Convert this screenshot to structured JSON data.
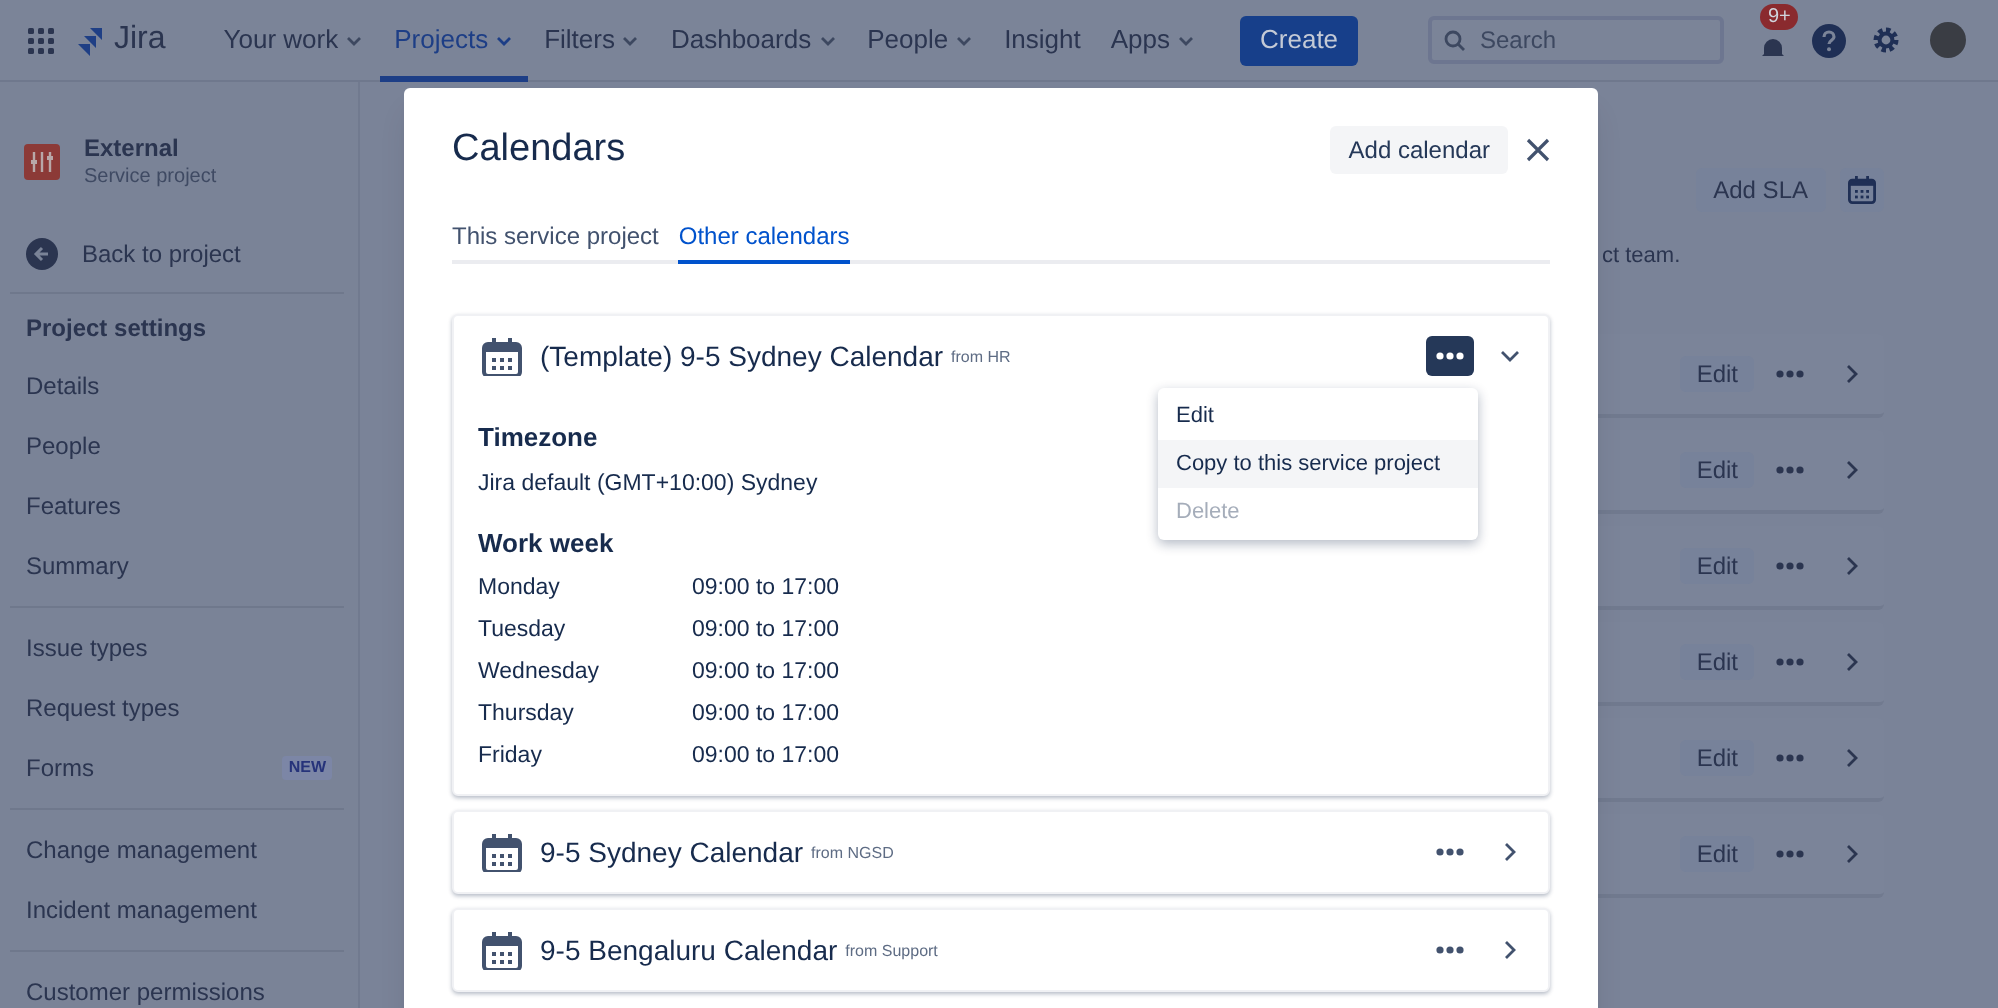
{
  "nav": {
    "logo": "Jira",
    "items": [
      {
        "label": "Your work",
        "dropdown": true,
        "selected": false
      },
      {
        "label": "Projects",
        "dropdown": true,
        "selected": true
      },
      {
        "label": "Filters",
        "dropdown": true,
        "selected": false
      },
      {
        "label": "Dashboards",
        "dropdown": true,
        "selected": false
      },
      {
        "label": "People",
        "dropdown": true,
        "selected": false
      },
      {
        "label": "Insight",
        "dropdown": false,
        "selected": false
      },
      {
        "label": "Apps",
        "dropdown": true,
        "selected": false
      }
    ],
    "create": "Create",
    "search": {
      "placeholder": "Search"
    },
    "notifications_badge": "9+"
  },
  "sidebar": {
    "project": {
      "name": "External",
      "type": "Service project"
    },
    "back": "Back to project",
    "heading": "Project settings",
    "groups": [
      [
        {
          "label": "Details"
        },
        {
          "label": "People"
        },
        {
          "label": "Features"
        },
        {
          "label": "Summary"
        }
      ],
      [
        {
          "label": "Issue types"
        },
        {
          "label": "Request types"
        },
        {
          "label": "Forms",
          "badge": "NEW"
        }
      ],
      [
        {
          "label": "Change management"
        },
        {
          "label": "Incident management"
        }
      ],
      [
        {
          "label": "Customer permissions"
        }
      ]
    ]
  },
  "page": {
    "add_sla": "Add SLA",
    "text_fragment": "ct team.",
    "rows": [
      {
        "action": "Edit"
      },
      {
        "action": "Edit"
      },
      {
        "action": "Edit"
      },
      {
        "action": "Edit"
      },
      {
        "action": "Edit"
      },
      {
        "action": "Edit"
      }
    ]
  },
  "modal": {
    "title": "Calendars",
    "add_button": "Add calendar",
    "tabs": [
      {
        "label": "This service project",
        "selected": false
      },
      {
        "label": "Other calendars",
        "selected": true
      }
    ],
    "calendars": [
      {
        "name": "(Template) 9-5 Sydney Calendar",
        "source": "from HR",
        "expanded": true,
        "menu_open": true,
        "timezone_heading": "Timezone",
        "timezone": "Jira default (GMT+10:00) Sydney",
        "work_week_heading": "Work week",
        "work_week": [
          {
            "day": "Monday",
            "hours": "09:00 to 17:00"
          },
          {
            "day": "Tuesday",
            "hours": "09:00 to 17:00"
          },
          {
            "day": "Wednesday",
            "hours": "09:00 to 17:00"
          },
          {
            "day": "Thursday",
            "hours": "09:00 to 17:00"
          },
          {
            "day": "Friday",
            "hours": "09:00 to 17:00"
          }
        ],
        "menu": [
          {
            "label": "Edit",
            "highlighted": false,
            "disabled": false
          },
          {
            "label": "Copy to this service project",
            "highlighted": true,
            "disabled": false
          },
          {
            "label": "Delete",
            "highlighted": false,
            "disabled": true
          }
        ]
      },
      {
        "name": "9-5 Sydney Calendar",
        "source": "from NGSD",
        "expanded": false,
        "menu_open": false
      },
      {
        "name": "9-5 Bengaluru Calendar",
        "source": "from Support",
        "expanded": false,
        "menu_open": false
      }
    ]
  }
}
